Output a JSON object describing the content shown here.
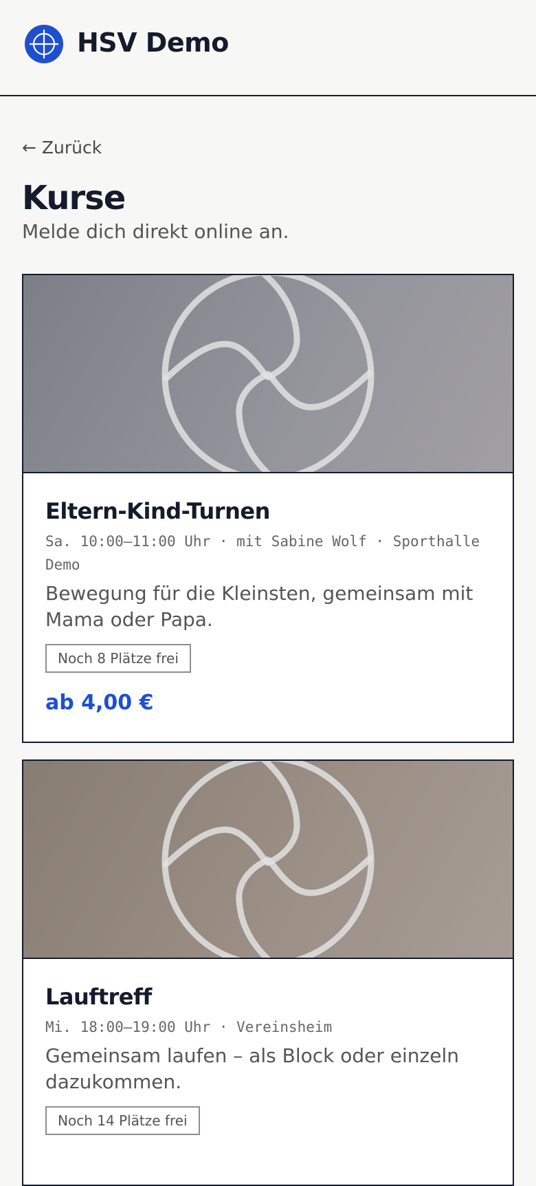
{
  "header": {
    "brand": "HSV Demo",
    "logo_icon": "crosshair-icon",
    "accent_color": "#1f4fd1"
  },
  "nav": {
    "back_label": "← Zurück"
  },
  "page": {
    "title": "Kurse",
    "subtitle": "Melde dich direkt online an."
  },
  "courses": [
    {
      "title": "Eltern-Kind-Turnen",
      "meta": "Sa. 10:00–11:00 Uhr · mit Sabine Wolf · Sporthalle Demo",
      "description": "Bewegung für die Kleinsten, gemeinsam mit Mama oder Papa.",
      "availability": "Noch 8 Plätze frei",
      "price": "ab 4,00 €",
      "image_icon": "ball-icon"
    },
    {
      "title": "Lauftreff",
      "meta": "Mi. 18:00–19:00 Uhr · Vereinsheim",
      "description": "Gemeinsam laufen – als Block oder einzeln dazukommen.",
      "availability": "Noch 14 Plätze frei",
      "image_icon": "ball-icon"
    }
  ]
}
